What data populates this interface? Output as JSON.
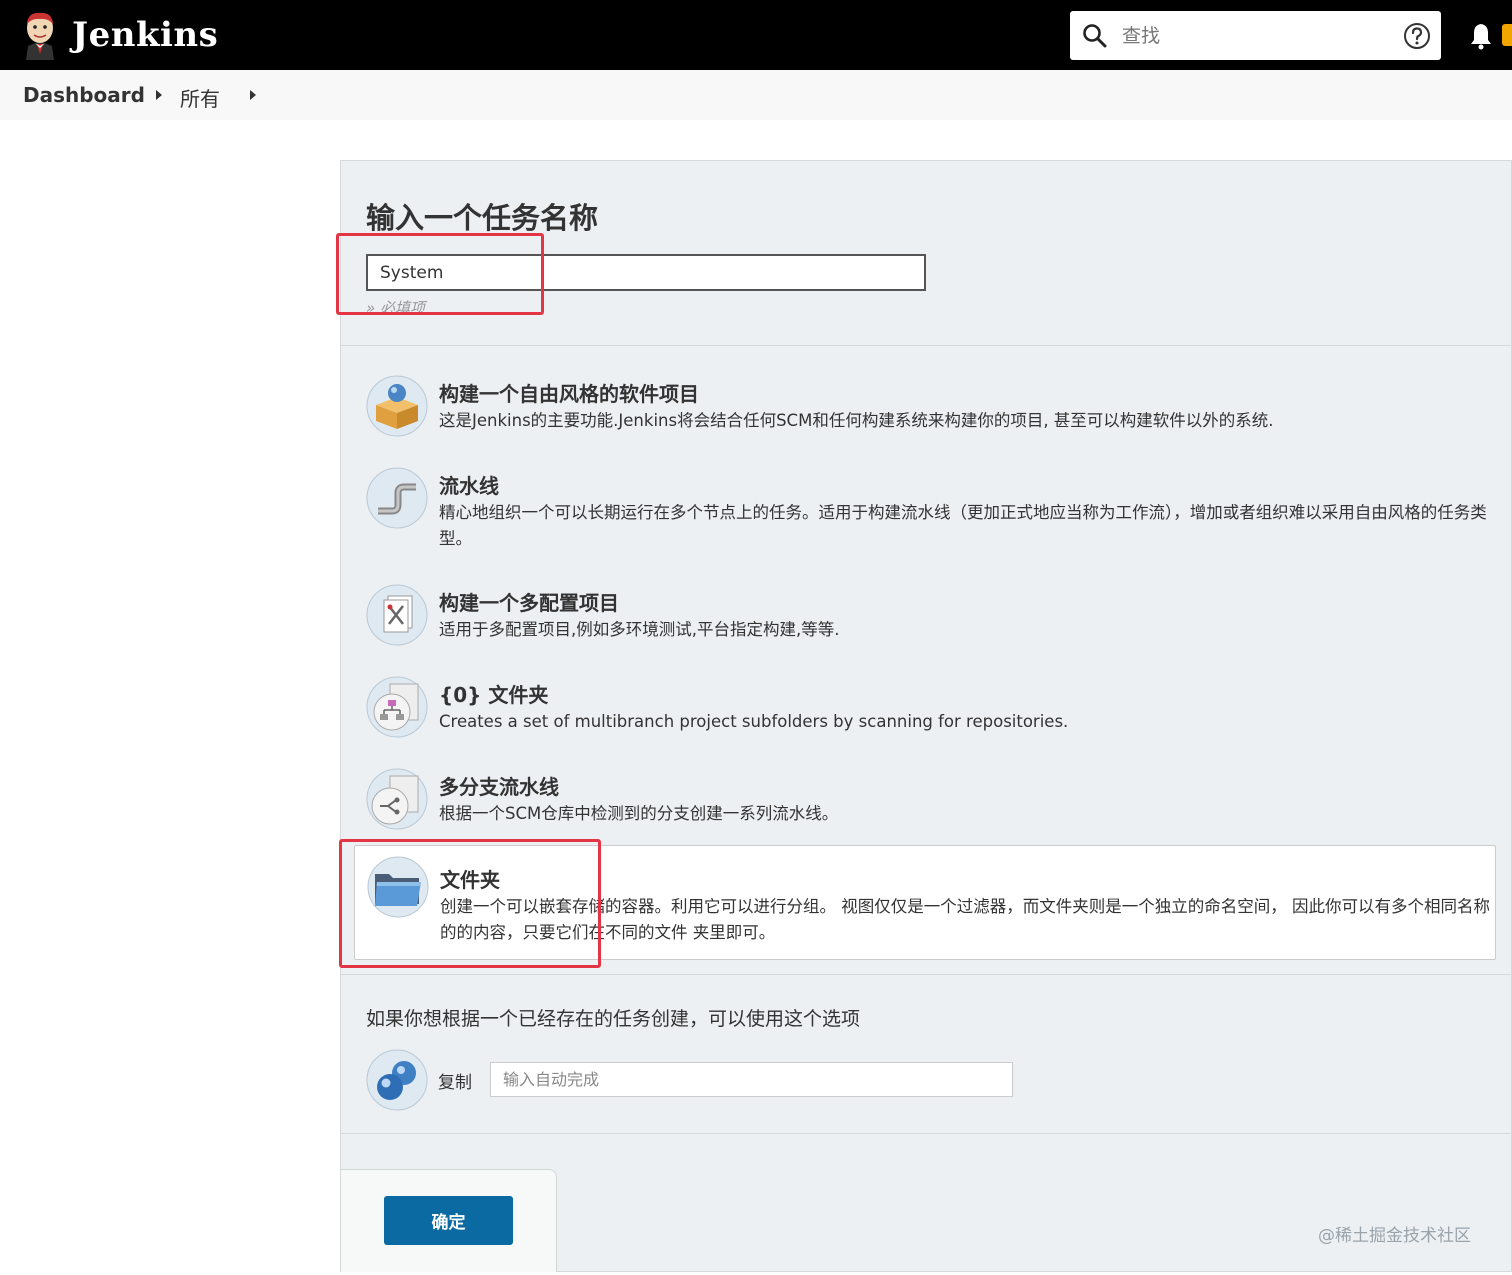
{
  "app": {
    "title": "Jenkins"
  },
  "header": {
    "search_placeholder": "查找"
  },
  "breadcrumb": {
    "items": [
      "Dashboard",
      "所有"
    ]
  },
  "new_item": {
    "title": "输入一个任务名称",
    "name_value": "System",
    "required_text": "» 必填项"
  },
  "item_types": [
    {
      "title": "构建一个自由风格的软件项目",
      "desc": "这是Jenkins的主要功能.Jenkins将会结合任何SCM和任何构建系统来构建你的项目, 甚至可以构建软件以外的系统.",
      "icon": "freestyle-package-icon"
    },
    {
      "title": "流水线",
      "desc": "精心地组织一个可以长期运行在多个节点上的任务。适用于构建流水线（更加正式地应当称为工作流），增加或者组织难以采用自由风格的任务类型。",
      "icon": "pipeline-icon"
    },
    {
      "title": "构建一个多配置项目",
      "desc": "适用于多配置项目,例如多环境测试,平台指定构建,等等.",
      "icon": "multi-config-icon"
    },
    {
      "title": "{0} 文件夹",
      "desc": "Creates a set of multibranch project subfolders by scanning for repositories.",
      "icon": "org-folder-icon"
    },
    {
      "title": "多分支流水线",
      "desc": "根据一个SCM仓库中检测到的分支创建一系列流水线。",
      "icon": "multibranch-icon"
    },
    {
      "title": "文件夹",
      "desc": "创建一个可以嵌套存储的容器。利用它可以进行分组。 视图仅仅是一个过滤器，而文件夹则是一个独立的命名空间， 因此你可以有多个相同名称的的内容，只要它们在不同的文件 夹里即可。",
      "icon": "folder-icon"
    }
  ],
  "copy": {
    "title": "如果你想根据一个已经存在的任务创建，可以使用这个选项",
    "label": "复制",
    "placeholder": "输入自动完成"
  },
  "buttons": {
    "ok": "确定"
  },
  "watermark": "@稀土掘金技术社区",
  "colors": {
    "highlight": "#e33545",
    "primary": "#0b6aa2",
    "header": "#000000"
  }
}
